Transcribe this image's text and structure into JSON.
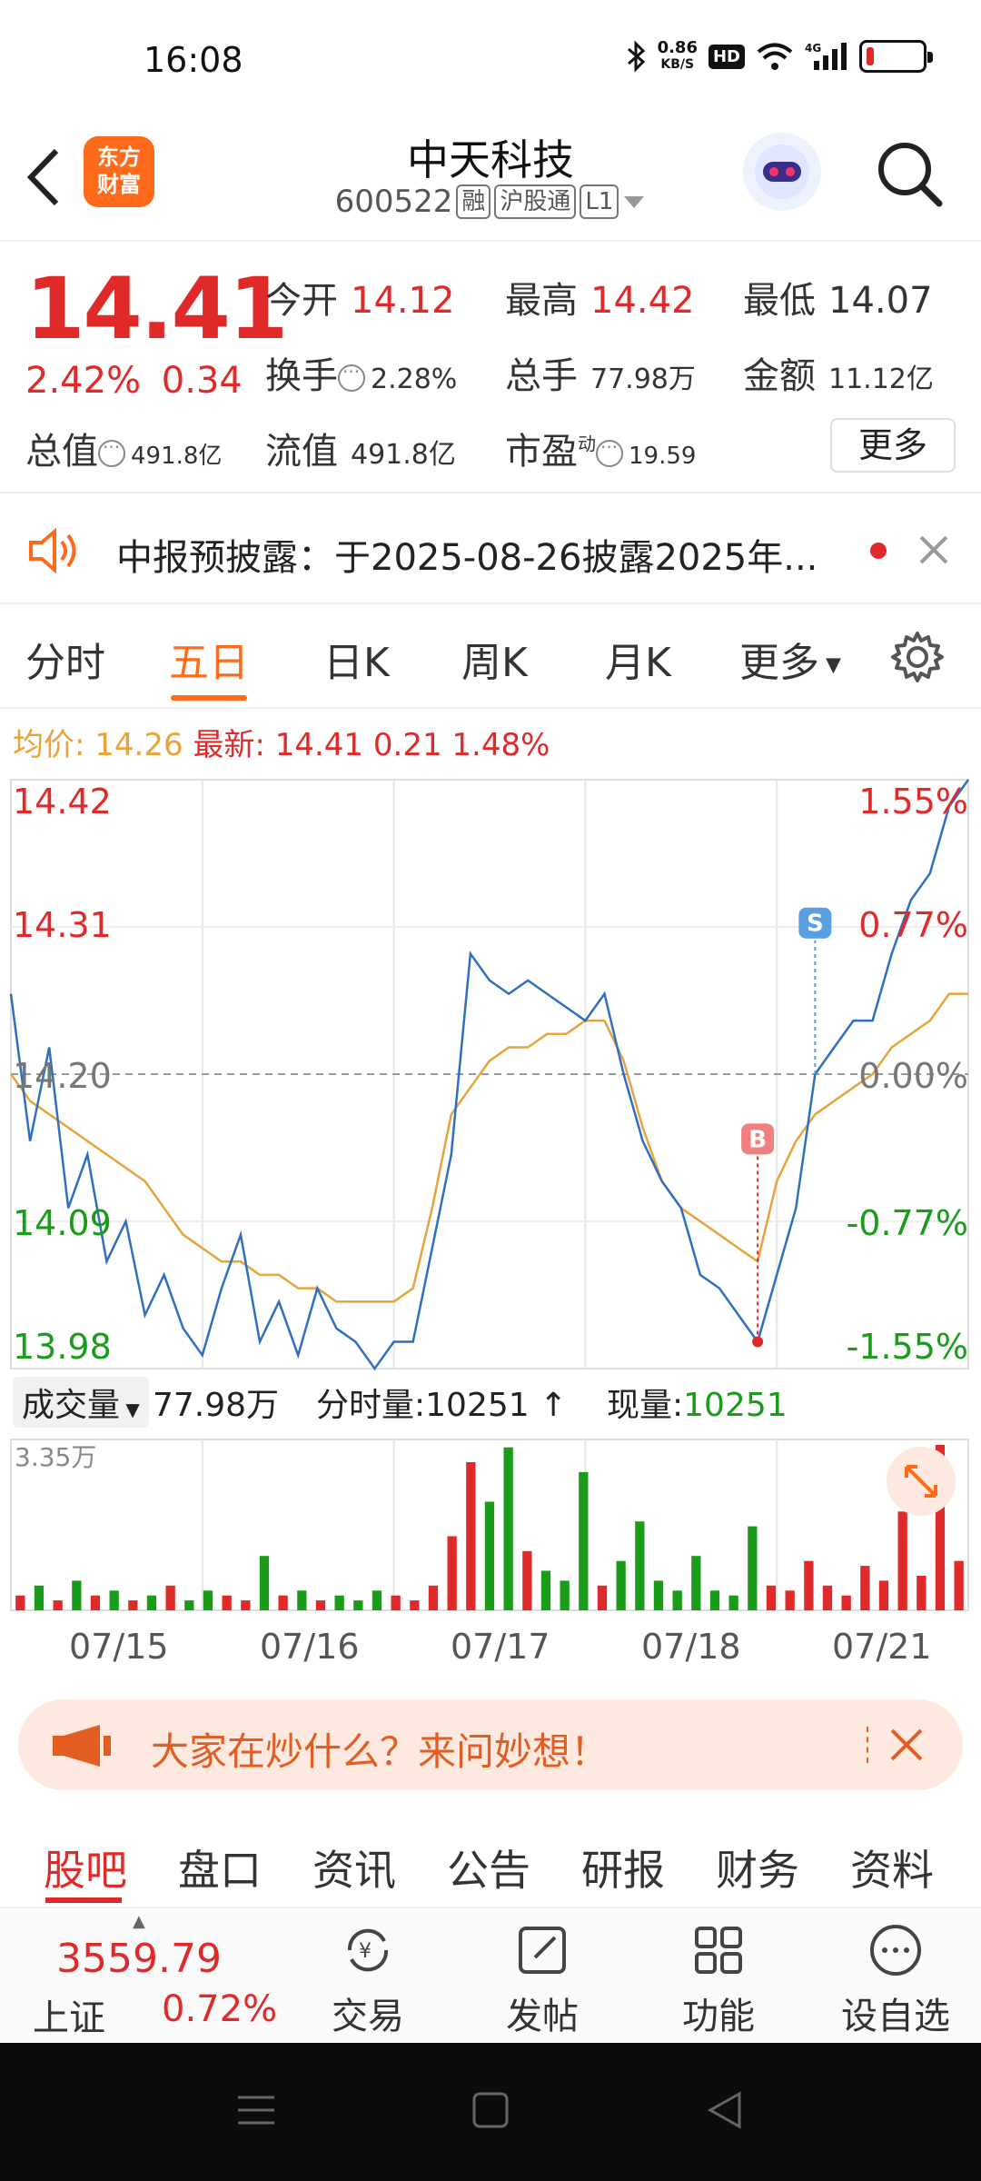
{
  "status": {
    "time": "16:08",
    "speed_top": "0.86",
    "speed_unit": "KB/S",
    "hd": "HD",
    "net": "4G"
  },
  "header": {
    "logo_text_1": "东方",
    "logo_text_2": "财富",
    "title": "中天科技",
    "code": "600522",
    "tag_margin": "融",
    "tag_connect": "沪股通",
    "tag_level": "L1"
  },
  "quote": {
    "price": "14.41",
    "change_pct": "2.42%",
    "change_abs": "0.34",
    "open_label": "今开",
    "open_value": "14.12",
    "high_label": "最高",
    "high_value": "14.42",
    "low_label": "最低",
    "low_value": "14.07",
    "turnover_label": "换手",
    "turnover_value": "2.28%",
    "volume_label": "总手",
    "volume_value": "77.98万",
    "amount_label": "金额",
    "amount_value": "11.12亿",
    "mktcap_label": "总值",
    "mktcap_value": "491.8亿",
    "float_label": "流值",
    "float_value": "491.8亿",
    "pe_label": "市盈",
    "pe_sup": "动",
    "pe_value": "19.59",
    "more_label": "更多"
  },
  "notice": {
    "text": "中报预披露：于2025-08-26披露2025年..."
  },
  "tabs": [
    "分时",
    "五日",
    "日K",
    "周K",
    "月K",
    "更多"
  ],
  "avg_bar": {
    "avg_label": "均价:",
    "avg_value": "14.26",
    "latest_label": "最新:",
    "latest_value": "14.41",
    "latest_chg": "0.21",
    "latest_pct": "1.48%"
  },
  "chart_data": {
    "type": "line",
    "title": "",
    "x_categories": [
      "07/15",
      "07/16",
      "07/17",
      "07/18",
      "07/21"
    ],
    "y_left_ticks": [
      "14.42",
      "14.31",
      "14.20",
      "14.09",
      "13.98"
    ],
    "y_right_ticks": [
      "1.55%",
      "0.77%",
      "0.00%",
      "-0.77%",
      "-1.55%"
    ],
    "ylim": [
      13.98,
      14.42
    ],
    "reference_price": 14.2,
    "series": [
      {
        "values": [
          14.26,
          14.15,
          14.22,
          14.1,
          14.14,
          14.06,
          14.09,
          14.02,
          14.05,
          14.01,
          13.99,
          14.04,
          14.08,
          14.0,
          14.03,
          13.99,
          14.04,
          14.01,
          14.0,
          13.98,
          14.0,
          14.0,
          14.07,
          14.14,
          14.29,
          14.27,
          14.26,
          14.27,
          14.26,
          14.25,
          14.24,
          14.26,
          14.2,
          14.15,
          14.12,
          14.1,
          14.05,
          14.04,
          14.02,
          14.0,
          14.05,
          14.1,
          14.2,
          14.22,
          14.24,
          14.24,
          14.29,
          14.33,
          14.35,
          14.4,
          14.42
        ]
      },
      {
        "name": "均价",
        "values": [
          14.2,
          14.18,
          14.17,
          14.16,
          14.15,
          14.14,
          14.13,
          14.12,
          14.1,
          14.08,
          14.07,
          14.06,
          14.06,
          14.05,
          14.05,
          14.04,
          14.04,
          14.03,
          14.03,
          14.03,
          14.03,
          14.04,
          14.1,
          14.17,
          14.19,
          14.21,
          14.22,
          14.22,
          14.23,
          14.23,
          14.24,
          14.24,
          14.21,
          14.16,
          14.12,
          14.1,
          14.09,
          14.08,
          14.07,
          14.06,
          14.12,
          14.15,
          14.17,
          14.18,
          14.19,
          14.2,
          14.22,
          14.23,
          14.24,
          14.26,
          14.26
        ]
      }
    ],
    "markers": [
      {
        "label": "B"
      },
      {
        "label": "S"
      }
    ],
    "volume": {
      "max_label": "3.35万",
      "values": [
        0.3,
        0.5,
        0.2,
        0.6,
        0.3,
        0.4,
        0.2,
        0.3,
        0.5,
        0.2,
        0.4,
        0.3,
        0.2,
        1.1,
        0.3,
        0.4,
        0.2,
        0.3,
        0.2,
        0.4,
        0.3,
        0.2,
        0.5,
        1.5,
        3.0,
        2.2,
        3.3,
        1.2,
        0.8,
        0.6,
        2.8,
        0.5,
        1.0,
        1.8,
        0.6,
        0.4,
        1.1,
        0.4,
        0.3,
        1.7,
        0.5,
        0.4,
        1.0,
        0.5,
        0.3,
        0.9,
        0.6,
        2.0,
        0.7,
        3.35,
        1.0
      ]
    }
  },
  "volume_bar": {
    "selector": "成交量",
    "total": "77.98万",
    "tick_label": "分时量:10251",
    "now_label": "现量:",
    "now_value": "10251"
  },
  "ask": {
    "text": "大家在炒什么？来问妙想！"
  },
  "subtabs": [
    "股吧",
    "盘口",
    "资讯",
    "公告",
    "研报",
    "财务",
    "资料"
  ],
  "bottom": {
    "index_value": "3559.79",
    "index_name": "上证",
    "index_pct": "0.72%",
    "nav": [
      "交易",
      "发帖",
      "功能",
      "设自选"
    ]
  },
  "colors": {
    "up": "#e02a2a",
    "down": "#1a9c1a",
    "accent": "#ff6a1a",
    "line": "#2f6fbf",
    "avg": "#e8a33a"
  }
}
